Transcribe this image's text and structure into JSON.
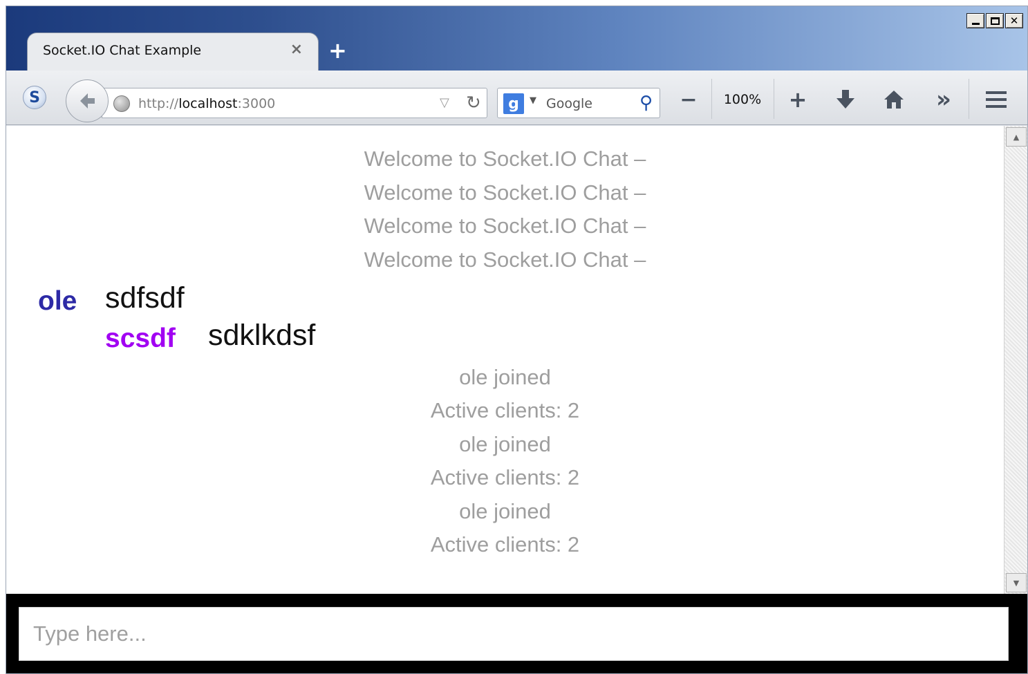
{
  "window": {
    "controls": {
      "minimize": "_",
      "maximize": "□",
      "close": "✕"
    }
  },
  "tab": {
    "title": "Socket.IO Chat Example",
    "close_glyph": "×",
    "new_tab_glyph": "+"
  },
  "toolbar": {
    "url_scheme": "http://",
    "url_host": "localhost",
    "url_port": ":3000",
    "search_placeholder": "Google",
    "zoom_out": "−",
    "zoom_level": "100%",
    "zoom_in": "+",
    "overflow": "»",
    "icons": [
      "skype-icon",
      "back-arrow-icon",
      "globe-icon",
      "dropmarker-icon",
      "reload-icon",
      "google-logo",
      "search-icon",
      "download-icon",
      "home-icon",
      "menu-icon"
    ]
  },
  "chat": {
    "welcome_messages": [
      "Welcome to Socket.IO Chat –",
      "Welcome to Socket.IO Chat –",
      "Welcome to Socket.IO Chat –",
      "Welcome to Socket.IO Chat –"
    ],
    "messages": [
      {
        "username": "ole",
        "body": "sdfsdf",
        "color": "#2d2aa6"
      },
      {
        "username": "scsdf",
        "body": "sdklkdsf",
        "color": "#a100f2"
      }
    ],
    "log": [
      "ole joined",
      "Active clients: 2",
      "ole joined",
      "Active clients: 2",
      "ole joined",
      "Active clients: 2"
    ]
  },
  "input": {
    "placeholder": "Type here..."
  },
  "colors": {
    "titlebar_start": "#1b3a7c",
    "titlebar_end": "#a8c4e8",
    "log_text": "#9e9e9e",
    "input_area": "#000000"
  }
}
